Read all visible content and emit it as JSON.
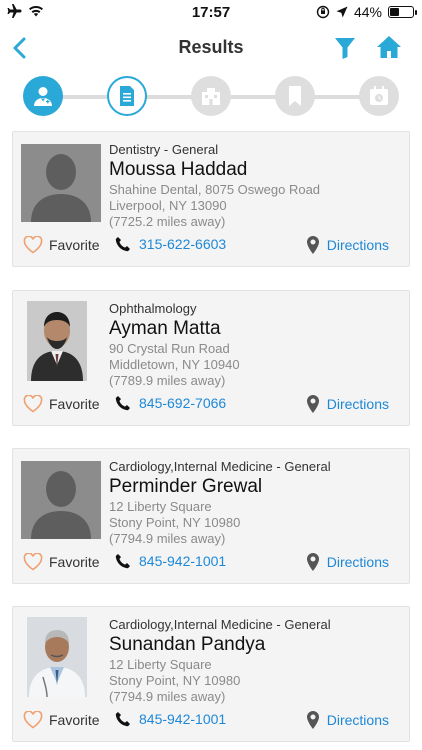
{
  "status_bar": {
    "time": "17:57",
    "battery": "44%",
    "battery_level": 0.44
  },
  "nav": {
    "title": "Results"
  },
  "colors": {
    "accent": "#2aa8d8",
    "link": "#1e88d8",
    "favorite": "#f0a070"
  },
  "steps": [
    {
      "icon": "doctor-icon",
      "state": "active"
    },
    {
      "icon": "document-icon",
      "state": "current"
    },
    {
      "icon": "building-icon",
      "state": "inactive"
    },
    {
      "icon": "bookmark-icon",
      "state": "inactive"
    },
    {
      "icon": "calendar-icon",
      "state": "inactive"
    }
  ],
  "results": [
    {
      "specialty": "Dentistry - General",
      "name": "Moussa Haddad",
      "address1": "Shahine Dental, 8075 Oswego Road",
      "address2": "Liverpool, NY 13090",
      "distance": "(7725.2 miles away)",
      "favorite": "Favorite",
      "phone": "315-622-6603",
      "directions": "Directions",
      "photo": "silhouette"
    },
    {
      "specialty": "Ophthalmology",
      "name": "Ayman Matta",
      "address1": "90 Crystal Run Road",
      "address2": "Middletown, NY 10940",
      "distance": "(7789.9 miles away)",
      "favorite": "Favorite",
      "phone": "845-692-7066",
      "directions": "Directions",
      "photo": "portrait-suit"
    },
    {
      "specialty": "Cardiology,Internal Medicine - General",
      "name": "Perminder Grewal",
      "address1": "12 Liberty Square",
      "address2": "Stony Point, NY 10980",
      "distance": "(7794.9 miles away)",
      "favorite": "Favorite",
      "phone": "845-942-1001",
      "directions": "Directions",
      "photo": "silhouette"
    },
    {
      "specialty": "Cardiology,Internal Medicine - General",
      "name": "Sunandan Pandya",
      "address1": "12 Liberty Square",
      "address2": "Stony Point, NY 10980",
      "distance": "(7794.9 miles away)",
      "favorite": "Favorite",
      "phone": "845-942-1001",
      "directions": "Directions",
      "photo": "portrait-coat"
    }
  ]
}
